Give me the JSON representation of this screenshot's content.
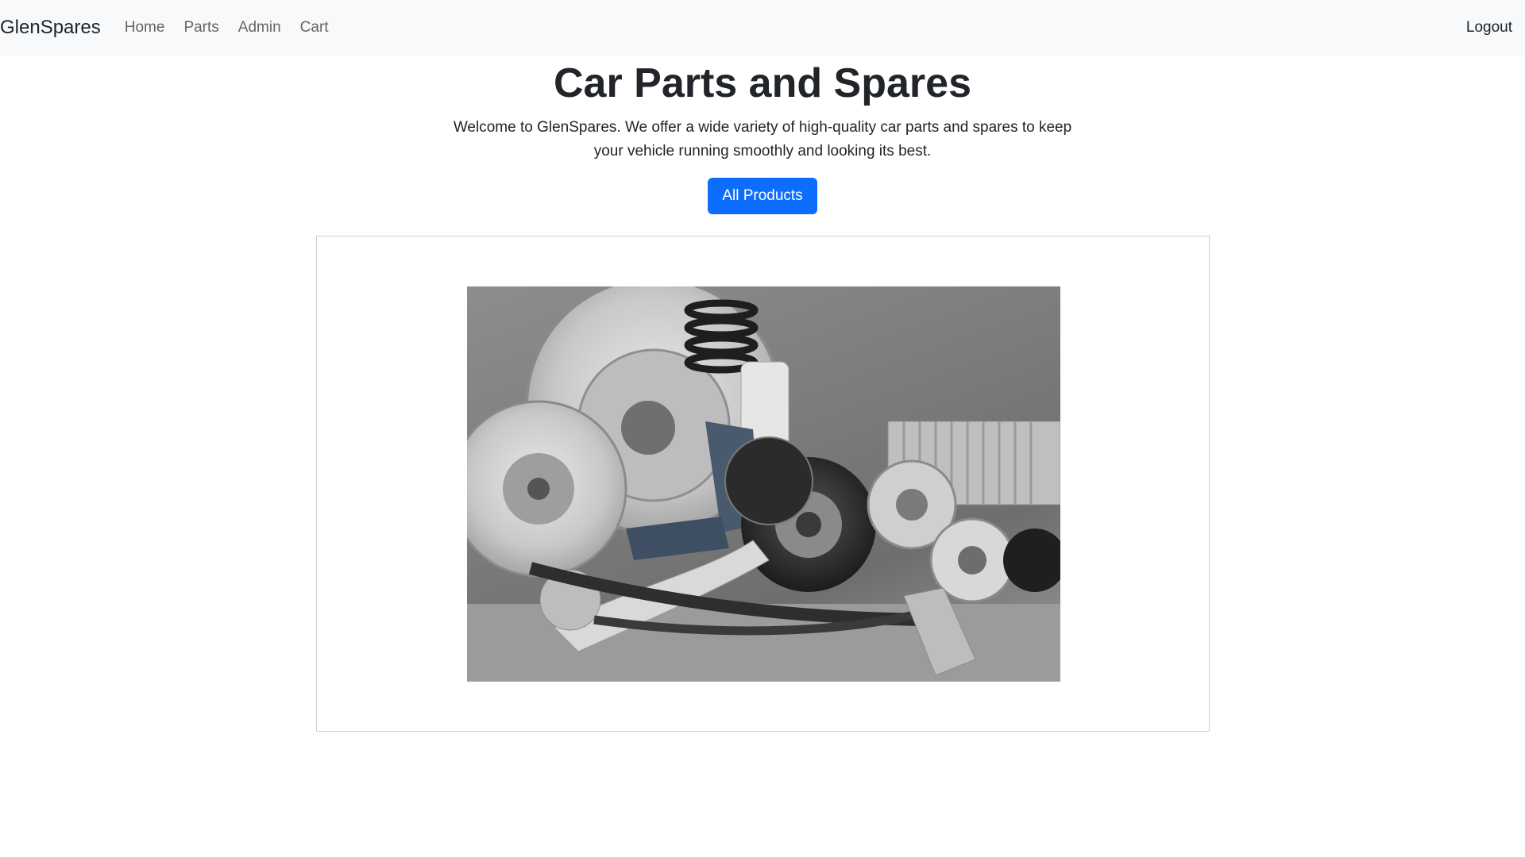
{
  "navbar": {
    "brand": "GlenSpares",
    "links": [
      "Home",
      "Parts",
      "Admin",
      "Cart"
    ],
    "logout": "Logout"
  },
  "hero": {
    "title": "Car Parts and Spares",
    "description": "Welcome to GlenSpares. We offer a wide variety of high-quality car parts and spares to keep your vehicle running smoothly and looking its best.",
    "button_label": "All Products"
  },
  "colors": {
    "accent": "#0d6efd",
    "navbar_bg": "#f8f9fa"
  }
}
